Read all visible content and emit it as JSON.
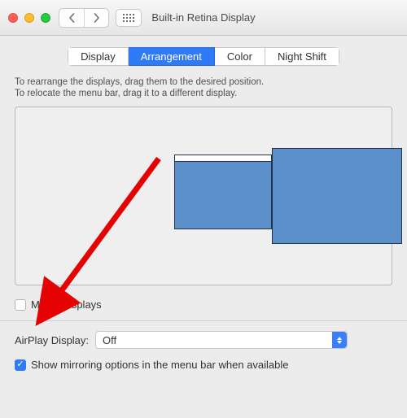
{
  "window": {
    "title": "Built-in Retina Display"
  },
  "tabs": {
    "display": "Display",
    "arrangement": "Arrangement",
    "color": "Color",
    "night_shift": "Night Shift"
  },
  "help": {
    "line1": "To rearrange the displays, drag them to the desired position.",
    "line2": "To relocate the menu bar, drag it to a different display."
  },
  "mirror": {
    "label": "Mirror Displays",
    "checked": false
  },
  "airplay": {
    "label": "AirPlay Display:",
    "value": "Off"
  },
  "show_mirroring": {
    "label": "Show mirroring options in the menu bar when available",
    "checked": true,
    "check_glyph": "✓"
  },
  "displays": {
    "primary_color": "#5b8fc9",
    "secondary_color": "#5b8fc9"
  }
}
